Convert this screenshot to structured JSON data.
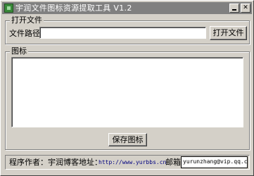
{
  "window": {
    "title": "宇润文件图标资源提取工具 V1.2",
    "min_glyph": "_",
    "close_glyph": "✕"
  },
  "open_file": {
    "legend": "打开文件",
    "path_label": "文件路径:",
    "path_value": "",
    "open_button": "打开文件"
  },
  "icon_group": {
    "legend": "图标",
    "save_button": "保存图标"
  },
  "status": {
    "author": "程序作者：宇润",
    "blog_label": "博客地址：",
    "blog_url": "http://www.yurbbs.cn",
    "mail_label": "邮箱：",
    "mail_value": "yurunzhang@vip.qq.com"
  }
}
